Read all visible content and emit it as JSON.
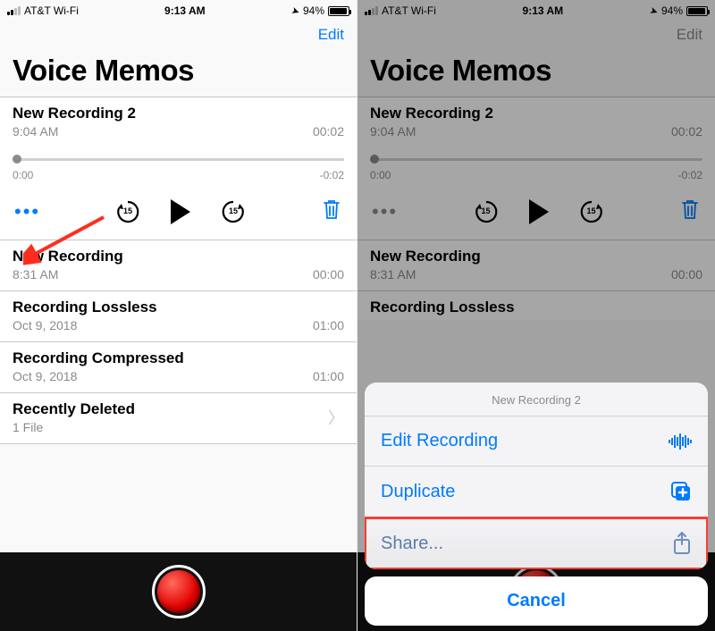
{
  "status": {
    "carrier": "AT&T Wi-Fi",
    "time": "9:13 AM",
    "battery_pct": "94%"
  },
  "nav": {
    "edit": "Edit"
  },
  "app_title": "Voice Memos",
  "selected": {
    "name": "New Recording 2",
    "time": "9:04 AM",
    "duration": "00:02",
    "scrub_start": "0:00",
    "scrub_end": "-0:02",
    "skip_seconds": "15"
  },
  "recordings": [
    {
      "name": "New Recording",
      "time": "8:31 AM",
      "duration": "00:00"
    },
    {
      "name": "Recording Lossless",
      "time": "Oct 9, 2018",
      "duration": "01:00"
    },
    {
      "name": "Recording Compressed",
      "time": "Oct 9, 2018",
      "duration": "01:00"
    }
  ],
  "rd": {
    "name": "Recently Deleted",
    "count": "1 File",
    "partial_name": "Recording Lossless"
  },
  "sheet": {
    "title": "New Recording 2",
    "edit": "Edit Recording",
    "duplicate": "Duplicate",
    "share": "Share...",
    "cancel": "Cancel"
  },
  "colors": {
    "accent": "#007aff",
    "danger": "#ff3b30"
  }
}
